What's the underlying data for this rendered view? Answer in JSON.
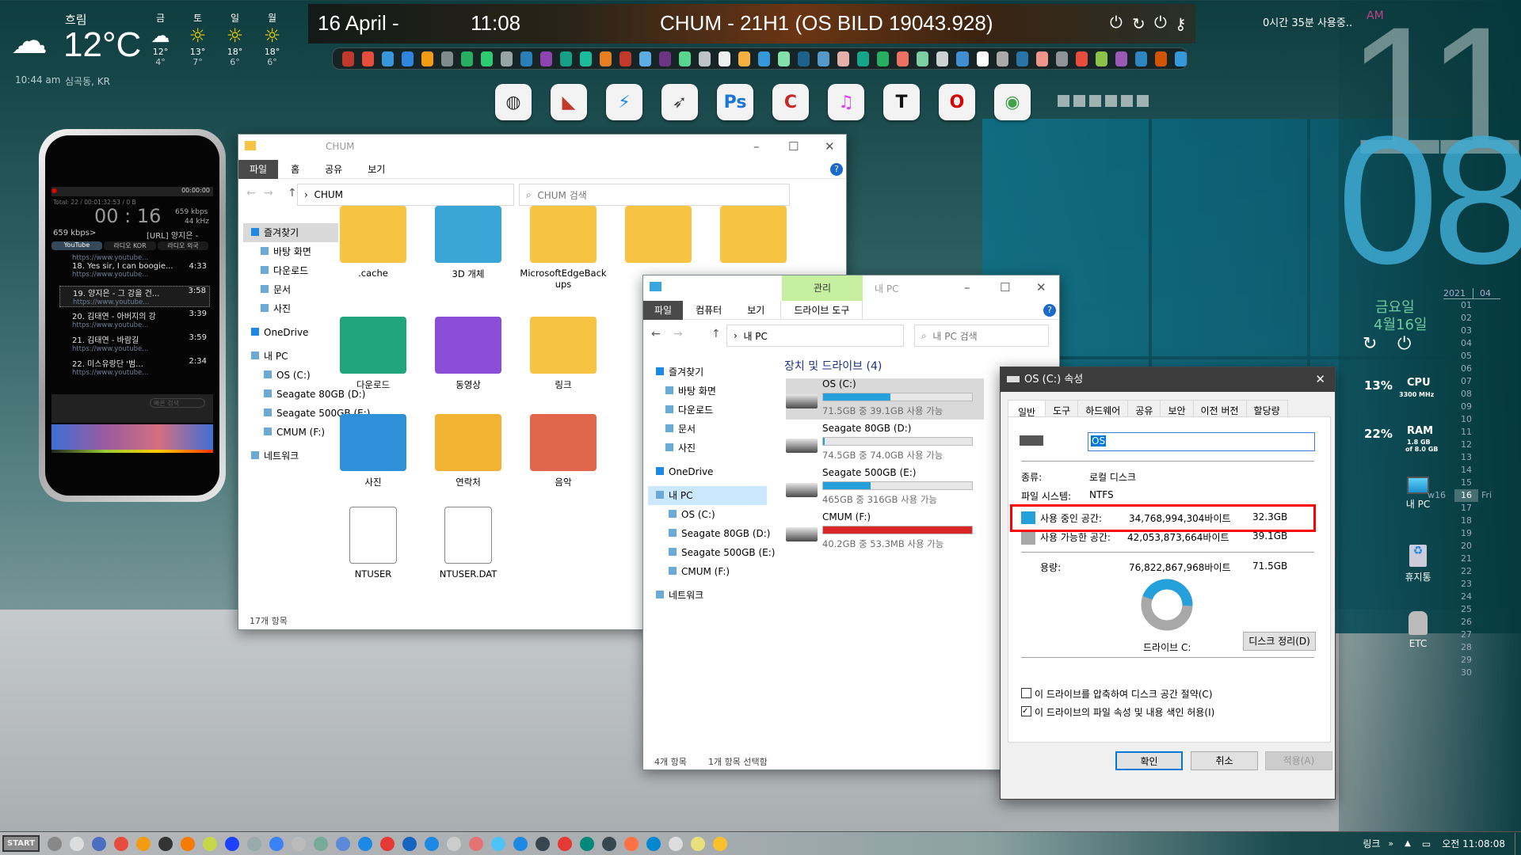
{
  "weather": {
    "condition": "흐림",
    "temp": "12°C",
    "time": "10:44 am",
    "location": "심곡동, KR",
    "forecast": [
      {
        "day": "금",
        "hi": "12°",
        "lo": "4°",
        "icon": "cloud-moon-icon"
      },
      {
        "day": "토",
        "hi": "13°",
        "lo": "7°",
        "icon": "sun-icon"
      },
      {
        "day": "일",
        "hi": "18°",
        "lo": "6°",
        "icon": "sun-icon"
      },
      {
        "day": "월",
        "hi": "18°",
        "lo": "6°",
        "icon": "sun-icon"
      }
    ]
  },
  "topbar": {
    "date": "16 April -",
    "time": "11:08",
    "title": "CHUM - 21H1 (OS BILD 19043.928)"
  },
  "quicklaunch": [
    "#c0392b",
    "#e74c3c",
    "#3498db",
    "#2e86de",
    "#f39c12",
    "#7f8c8d",
    "#27ae60",
    "#2ecc71",
    "#95a5a6",
    "#2980b9",
    "#8e44ad",
    "#16a085",
    "#1abc9c",
    "#e67e22",
    "#c0392b",
    "#5dade2",
    "#6c3483",
    "#58d68d",
    "#bdc3c7",
    "#ecf0f1",
    "#f5b041",
    "#3498db",
    "#82e0aa",
    "#1f618d",
    "#5499c7",
    "#e6b0aa",
    "#17a589",
    "#27ae60",
    "#ec7063",
    "#7dcea0",
    "#ccd1d1",
    "#3f8fd2",
    "#ffffff",
    "#aaaaaa",
    "#2874a6",
    "#f1948a",
    "#909497",
    "#e74c3c",
    "#8bc34a",
    "#9b59b6",
    "#2e86c1",
    "#d35400",
    "#3498db"
  ],
  "dock": [
    {
      "name": "globe-app-icon",
      "glyph": "◍",
      "color": "#333"
    },
    {
      "name": "chart-app-icon",
      "glyph": "◣",
      "color": "#c0392b"
    },
    {
      "name": "bolt-app-icon",
      "glyph": "⚡",
      "color": "#1e88e5"
    },
    {
      "name": "broom-app-icon",
      "glyph": "➶",
      "color": "#444"
    },
    {
      "name": "photoshop-icon",
      "glyph": "Ps",
      "color": "#1976d2"
    },
    {
      "name": "ccleaner-icon",
      "glyph": "C",
      "color": "#c62828"
    },
    {
      "name": "music-icon",
      "glyph": "♫",
      "color": "#e040fb"
    },
    {
      "name": "typora-icon",
      "glyph": "T",
      "color": "#111"
    },
    {
      "name": "opera-icon",
      "glyph": "O",
      "color": "#d50000"
    },
    {
      "name": "chrome-icon",
      "glyph": "◉",
      "color": "#43a047"
    }
  ],
  "usage": {
    "text": "0시간 35분 사용중..",
    "ampm": "AM"
  },
  "clock": {
    "hour": "11",
    "minute": "08"
  },
  "dateWidget": {
    "weekday": "금요일",
    "date": "4월16일"
  },
  "sys": {
    "cpu_pct": "13%",
    "cpu": "CPU",
    "cpu_mhz": "3300 MHz",
    "ram_pct": "22%",
    "ram": "RAM",
    "ram_used": "1.8 GB",
    "ram_total": "of 8.0 GB"
  },
  "calendar": {
    "year": "2021",
    "month": "04",
    "week": "w16",
    "today_name": "Fri",
    "days": [
      "01",
      "02",
      "03",
      "04",
      "05",
      "06",
      "07",
      "08",
      "09",
      "10",
      "11",
      "12",
      "13",
      "14",
      "15",
      "16",
      "17",
      "18",
      "19",
      "20",
      "21",
      "22",
      "23",
      "24",
      "25",
      "26",
      "27",
      "28",
      "29",
      "30"
    ]
  },
  "desktop": [
    {
      "label": "내 PC"
    },
    {
      "label": "휴지통"
    },
    {
      "label": "ETC"
    }
  ],
  "player": {
    "status_time": "00:00:00",
    "total": "Total:  22  /  00:01:32:53  /  0 B",
    "elapsed": "00 : 16",
    "kbps": "659 kbps",
    "khz": "44 kHz",
    "bitrate": "659 kbps>",
    "nowplaying": "[URL] 양지은 -",
    "tabs": [
      "YouTube",
      "라디오 KOR",
      "라디오 외국"
    ],
    "url": "https://www.youtube...",
    "items": [
      {
        "title": "18. Yes sir, I can boogie...",
        "dur": "4:33"
      },
      {
        "title": "19. 양지은 - 그 강을 건...",
        "dur": "3:58"
      },
      {
        "title": "20. 김태연 - 아버지의 강",
        "dur": "3:39"
      },
      {
        "title": "21. 김태연 - 바람길",
        "dur": "3:59"
      },
      {
        "title": "22. 미스유랑단 '범...",
        "dur": "2:34"
      }
    ],
    "search_placeholder": "빠른 검색"
  },
  "chum": {
    "title": "CHUM",
    "tabs": [
      "파일",
      "홈",
      "공유",
      "보기"
    ],
    "path": "CHUM",
    "search": "CHUM 검색",
    "nav": [
      "즐겨찾기",
      "바탕 화면",
      "다운로드",
      "문서",
      "사진",
      "OneDrive",
      "내 PC",
      "OS (C:)",
      "Seagate 80GB (D:)",
      "Seagate 500GB (E:)",
      "CMUM (F:)",
      "네트워크"
    ],
    "files": [
      {
        "name": ".cache",
        "color": "#f6c343"
      },
      {
        "name": "3D 개체",
        "color": "#3aa6d8"
      },
      {
        "name": "MicrosoftEdgeBackups",
        "color": "#f6c343"
      },
      {
        "name": "",
        "color": "#f6c343"
      },
      {
        "name": "",
        "color": "#f6c343"
      },
      {
        "name": "다운로드",
        "color": "#1fa57a"
      },
      {
        "name": "동영상",
        "color": "#8a4fd6"
      },
      {
        "name": "링크",
        "color": "#f6c343"
      },
      {
        "name": "사진",
        "color": "#2f8fd8"
      },
      {
        "name": "연락처",
        "color": "#f2b233"
      },
      {
        "name": "음악",
        "color": "#e1664c"
      },
      {
        "name": "NTUSER",
        "color": "#ffffff"
      },
      {
        "name": "NTUSER.DAT",
        "color": "#ffffff"
      }
    ],
    "status": "17개 항목"
  },
  "mypc": {
    "title": "내 PC",
    "manage": "관리",
    "tabs": [
      "파일",
      "컴퓨터",
      "보기",
      "드라이브 도구"
    ],
    "path": "내 PC",
    "search": "내 PC 검색",
    "section": "장치 및 드라이브 (4)",
    "nav": [
      "즐겨찾기",
      "바탕 화면",
      "다운로드",
      "문서",
      "사진",
      "OneDrive",
      "내 PC",
      "OS (C:)",
      "Seagate 80GB (D:)",
      "Seagate 500GB (E:)",
      "CMUM (F:)",
      "네트워크"
    ],
    "drives": [
      {
        "name": "OS (C:)",
        "free": "71.5GB 중 39.1GB 사용 가능",
        "used_fraction": 0.45,
        "color": "#26a0da"
      },
      {
        "name": "Seagate 80GB (D:)",
        "free": "74.5GB 중 74.0GB 사용 가능",
        "used_fraction": 0.01,
        "color": "#26a0da"
      },
      {
        "name": "Seagate 500GB (E:)",
        "free": "465GB 중 316GB 사용 가능",
        "used_fraction": 0.32,
        "color": "#26a0da"
      },
      {
        "name": "CMUM (F:)",
        "free": "40.2GB 중 53.3MB 사용 가능",
        "used_fraction": 0.999,
        "color": "#da2626"
      }
    ],
    "status": "4개 항목",
    "selected": "1개 항목 선택함"
  },
  "props": {
    "title": "OS (C:) 속성",
    "tabs": [
      "일반",
      "도구",
      "하드웨어",
      "공유",
      "보안",
      "이전 버전",
      "할당량"
    ],
    "name_value": "OS",
    "type_label": "종류:",
    "type": "로컬 디스크",
    "fs_label": "파일 시스템:",
    "fs": "NTFS",
    "used_label": "사용 중인 공간:",
    "used_bytes": "34,768,994,304바이트",
    "used_gb": "32.3GB",
    "free_label": "사용 가능한 공간:",
    "free_bytes": "42,053,873,664바이트",
    "free_gb": "39.1GB",
    "cap_label": "용량:",
    "cap_bytes": "76,822,867,968바이트",
    "cap_gb": "71.5GB",
    "used_fraction": 0.45,
    "drive_label": "드라이브 C:",
    "cleanup": "디스크 정리(D)",
    "compress": "이 드라이브를 압축하여 디스크 공간 절약(C)",
    "compress_checked": false,
    "index": "이 드라이브의 파일 속성 및 내용 색인 허용(I)",
    "index_checked": true,
    "ok": "확인",
    "cancel": "취소",
    "apply": "적용(A)",
    "used_color": "#26a0da",
    "free_color": "#a8a8a8",
    "highlight": "#ff0000"
  },
  "taskbar": {
    "start": "START",
    "links": "링크",
    "time": "오전 11:08:08",
    "icons": [
      "#888",
      "#ddd",
      "#4a6fc1",
      "#e74c3c",
      "#f39c12",
      "#333",
      "#f57c00",
      "#c6d84a",
      "#1e40ff",
      "#9aa",
      "#3b82f6",
      "#bbb",
      "#7a9",
      "#5b8bd8",
      "#1e88e5",
      "#e53935",
      "#1565c0",
      "#1e88e5",
      "#ccc",
      "#e57373",
      "#4fc3f7",
      "#1e88e5",
      "#37474f",
      "#e53935",
      "#00897b",
      "#37474f",
      "#ff7043",
      "#0288d1",
      "#ddd",
      "#e8e07a",
      "#fbc02d"
    ]
  }
}
